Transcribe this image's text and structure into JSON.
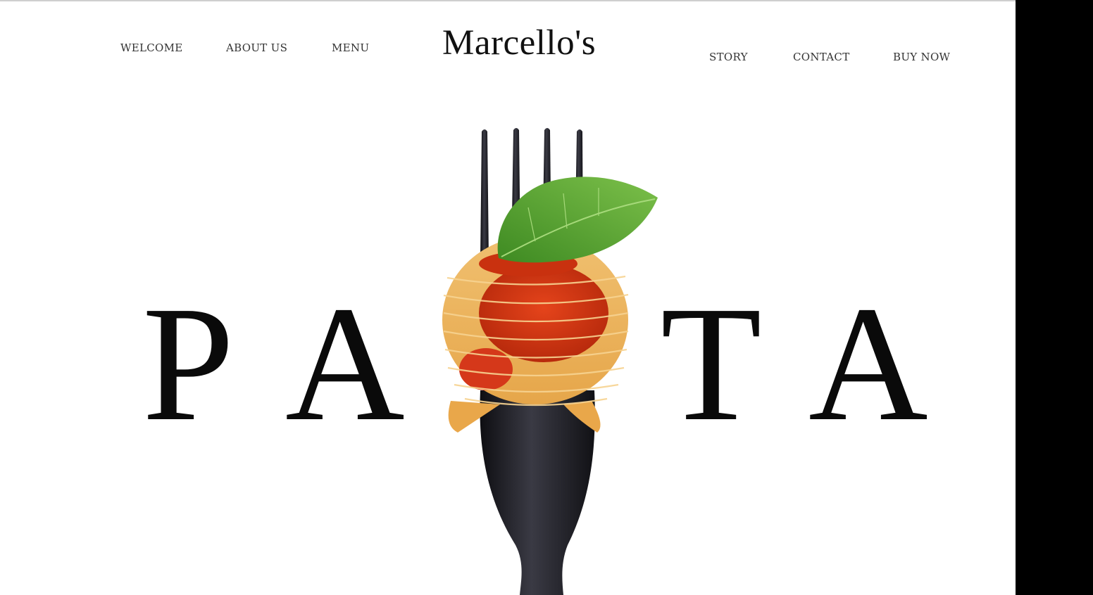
{
  "nav": {
    "left": [
      "WELCOME",
      "ABOUT US",
      "MENU"
    ],
    "right": [
      "STORY",
      "CONTACT",
      "BUY NOW"
    ]
  },
  "brand": "Marcello's",
  "hero": {
    "letters": [
      "P",
      "A",
      "T",
      "A"
    ],
    "image_subject": "spaghetti-on-fork-with-basil"
  },
  "colors": {
    "text": "#111111",
    "fork": "#1c1c20",
    "sauce": "#d83a14",
    "basil": "#4f9a2c"
  }
}
